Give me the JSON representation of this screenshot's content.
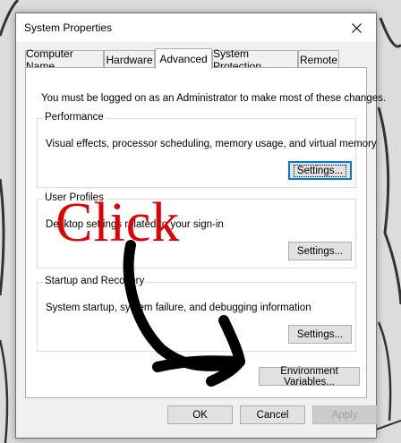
{
  "window": {
    "title": "System Properties"
  },
  "tabs": [
    {
      "label": "Computer Name"
    },
    {
      "label": "Hardware"
    },
    {
      "label": "Advanced"
    },
    {
      "label": "System Protection"
    },
    {
      "label": "Remote"
    }
  ],
  "active_tab": "Advanced",
  "admin_note": "You must be logged on as an Administrator to make most of these changes.",
  "groups": {
    "performance": {
      "title": "Performance",
      "description": "Visual effects, processor scheduling, memory usage, and virtual memory",
      "button": "Settings..."
    },
    "user_profiles": {
      "title": "User Profiles",
      "description": "Desktop settings related to your sign-in",
      "button": "Settings..."
    },
    "startup_recovery": {
      "title": "Startup and Recovery",
      "description": "System startup, system failure, and debugging information",
      "button": "Settings..."
    }
  },
  "environment_button": "Environment Variables...",
  "footer": {
    "ok": "OK",
    "cancel": "Cancel",
    "apply": "Apply"
  },
  "annotation": {
    "text": "Click",
    "color": "#e00000"
  },
  "icons": {
    "close": "close-icon"
  }
}
